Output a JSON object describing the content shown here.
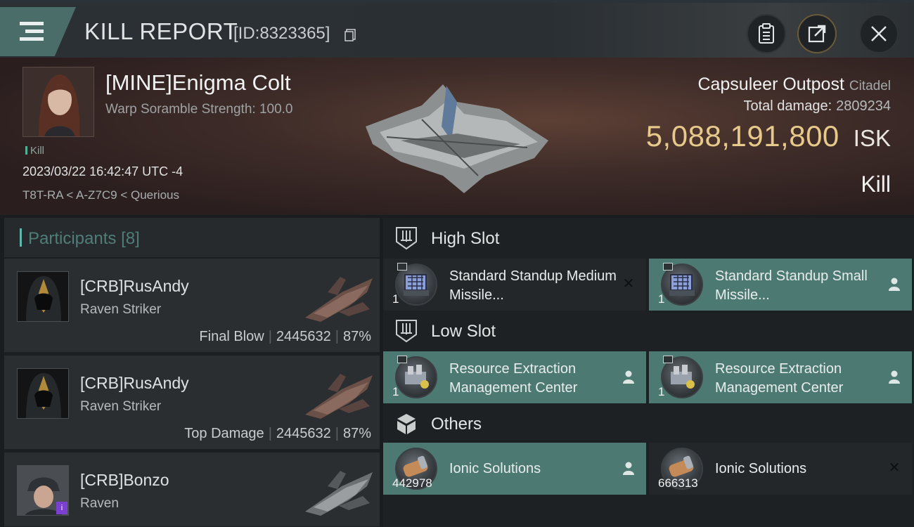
{
  "header": {
    "title": "KILL REPORT",
    "report_id": "[ID:8323365]",
    "buttons": [
      "clipboard-icon",
      "share-icon",
      "close-icon"
    ]
  },
  "victim": {
    "name": "[MINE]Enigma Colt",
    "warp_scramble": "Warp Soramble Strength: 100.0",
    "tag": "Kill",
    "datetime": "2023/03/22 16:42:47 UTC -4",
    "location": "T8T-RA < A-Z7C9 < Querious"
  },
  "target": {
    "name": "Capsuleer Outpost",
    "type": "Citadel",
    "total_damage_label": "Total damage:",
    "total_damage": "2809234",
    "isk_value": "5,088,191,800",
    "isk_unit": "ISK",
    "result": "Kill"
  },
  "participants": {
    "label": "Participants",
    "count": "[8]",
    "items": [
      {
        "name": "[CRB]RusAndy",
        "ship": "Raven Striker",
        "role": "Final Blow",
        "damage": "2445632",
        "percent": "87%"
      },
      {
        "name": "[CRB]RusAndy",
        "ship": "Raven Striker",
        "role": "Top Damage",
        "damage": "2445632",
        "percent": "87%"
      },
      {
        "name": "[CRB]Bonzo",
        "ship": "Raven",
        "badge": "i"
      }
    ]
  },
  "slots": {
    "high": {
      "label": "High Slot",
      "items": [
        {
          "name": "Standard Standup Medium Missile...",
          "qty": "1",
          "action": "✕"
        },
        {
          "name": "Standard Standup Small Missile...",
          "qty": "1",
          "action": "person-icon"
        }
      ]
    },
    "low": {
      "label": "Low Slot",
      "items": [
        {
          "name": "Resource Extraction Management Center",
          "qty": "1",
          "action": "person-icon"
        },
        {
          "name": "Resource Extraction Management Center",
          "qty": "1",
          "action": "person-icon"
        }
      ]
    },
    "others": {
      "label": "Others",
      "items": [
        {
          "name": "Ionic Solutions",
          "qty": "442978",
          "action": "person-icon"
        },
        {
          "name": "Ionic Solutions",
          "qty": "666313",
          "action": "✕"
        }
      ]
    }
  },
  "colors": {
    "accent": "#4c7a72",
    "isk": "#e6c98b",
    "menu": "#4a6d6a"
  }
}
